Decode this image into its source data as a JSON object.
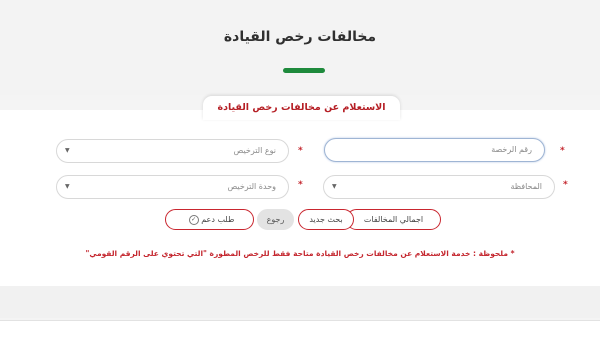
{
  "page_title": "مخالفات رخص القيادة",
  "section_title": "الاستعلام عن مخالفات رخص القيادة",
  "required_mark": "*",
  "form": {
    "license_number_placeholder": "رقم الرخصة",
    "license_type_placeholder": "نوع الترخيص",
    "governorate_placeholder": "المحافظة",
    "licensing_unit_placeholder": "وحدة الترخيص",
    "dropdown_caret": "▼"
  },
  "buttons": {
    "total_violations": "اجمالي المخالفات",
    "new_search": "بحث جديد",
    "back": "رجوع",
    "support_request": "طلب دعم",
    "support_icon_glyph": "✓"
  },
  "note": "* ملحوظة : خدمة الاستعلام عن مخالفات رخص القيادة متاحة فقط للرخص المطورة \"التي تحتوي على الرقم القومي\"",
  "colors": {
    "accent_red": "#c4262e",
    "accent_green": "#1e8a3c"
  }
}
